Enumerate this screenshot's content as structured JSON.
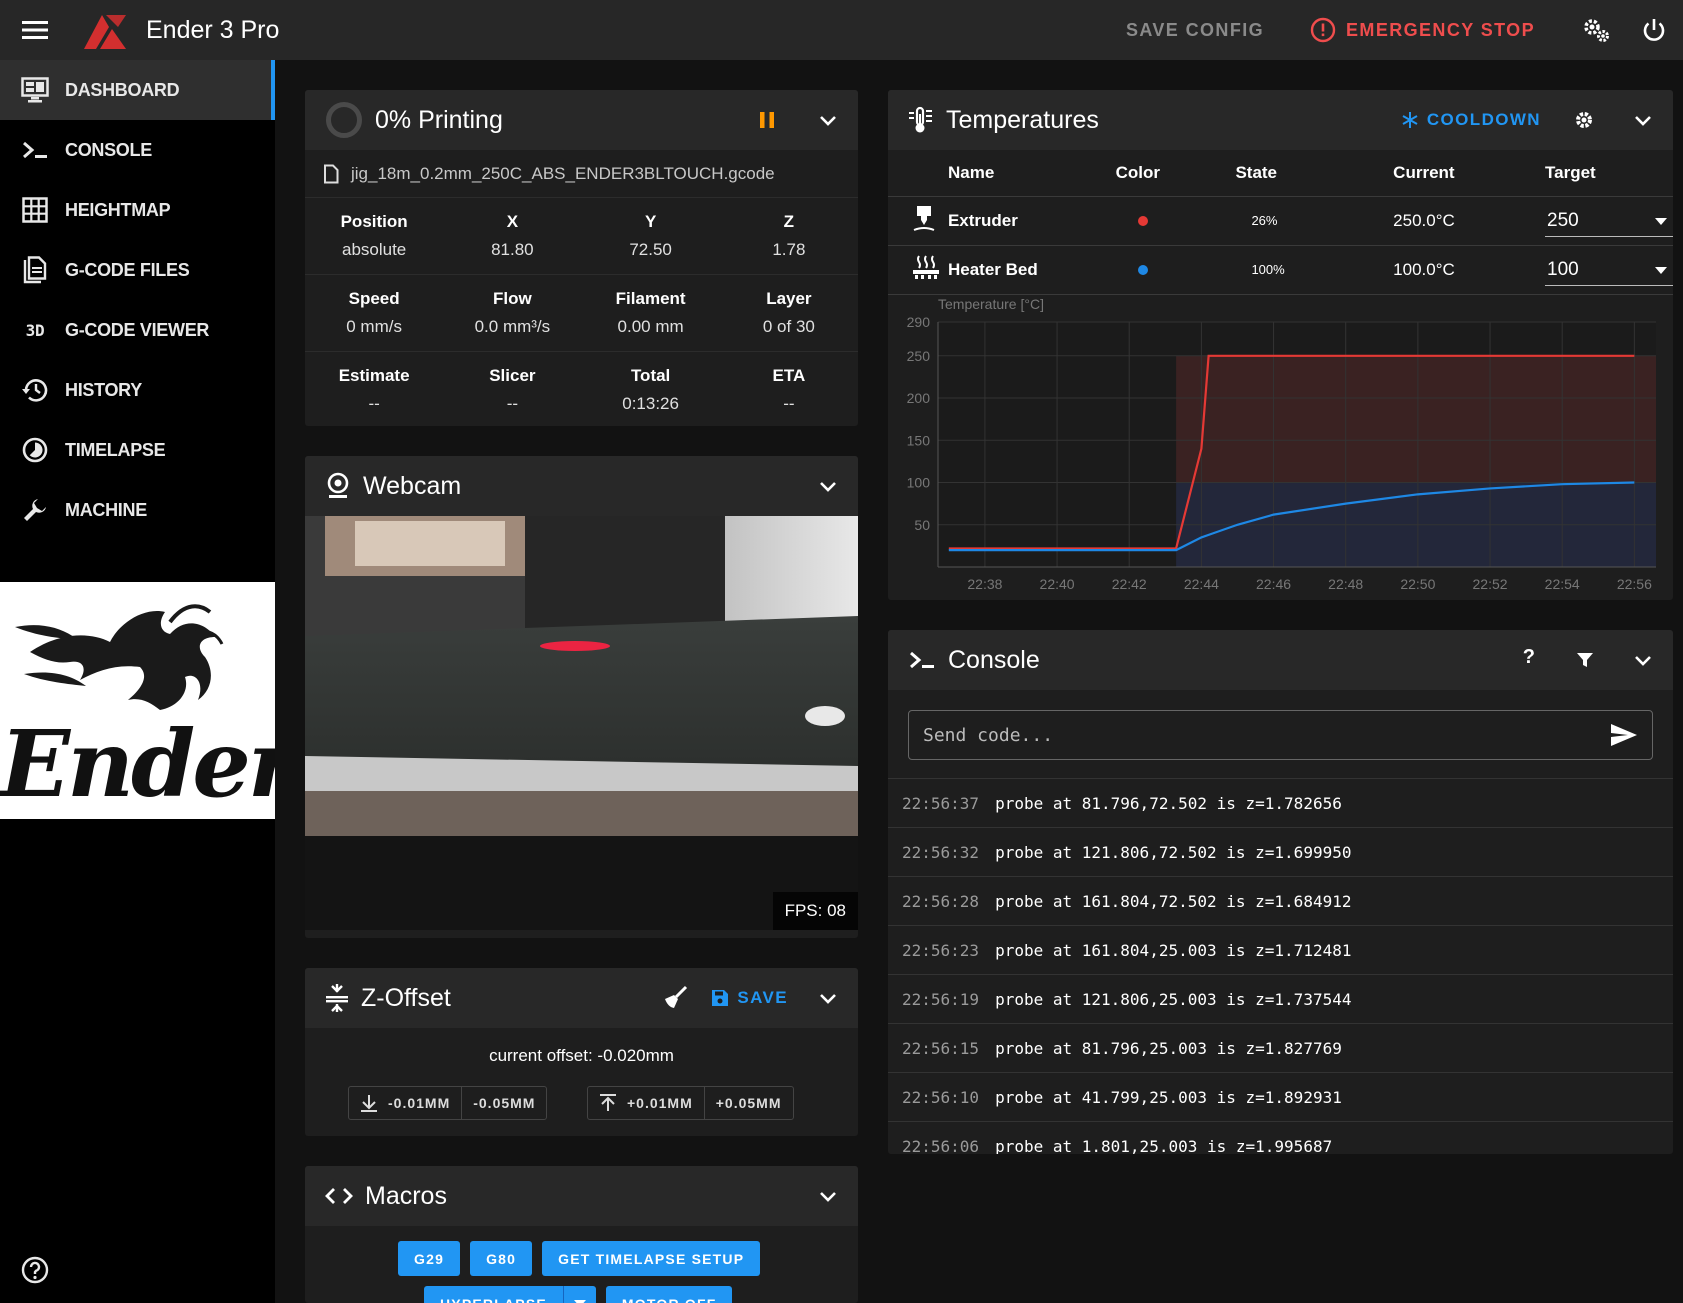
{
  "app": {
    "title": "Ender 3 Pro",
    "save_config": "SAVE CONFIG",
    "emergency_stop": "EMERGENCY STOP",
    "accent": "#2196f3",
    "danger": "#ef4d4d",
    "warning": "#ff9800"
  },
  "sidebar": {
    "items": [
      {
        "label": "DASHBOARD",
        "icon": "monitor-dashboard-icon",
        "active": true
      },
      {
        "label": "CONSOLE",
        "icon": "console-icon"
      },
      {
        "label": "HEIGHTMAP",
        "icon": "grid-icon"
      },
      {
        "label": "G-CODE FILES",
        "icon": "file-document-icon"
      },
      {
        "label": "G-CODE VIEWER",
        "icon": "3d-icon",
        "icon_text": "3D"
      },
      {
        "label": "HISTORY",
        "icon": "history-icon"
      },
      {
        "label": "TIMELAPSE",
        "icon": "timelapse-icon"
      },
      {
        "label": "MACHINE",
        "icon": "wrench-icon"
      }
    ],
    "logo_text": "Ender"
  },
  "status": {
    "title": "0% Printing",
    "progress": 0,
    "file": "jig_18m_0.2mm_250C_ABS_ENDER3BLTOUCH.gcode",
    "row1": {
      "headers": [
        "Position",
        "X",
        "Y",
        "Z"
      ],
      "values": [
        "absolute",
        "81.80",
        "72.50",
        "1.78"
      ]
    },
    "row2": {
      "headers": [
        "Speed",
        "Flow",
        "Filament",
        "Layer"
      ],
      "values": [
        "0 mm/s",
        "0.0 mm³/s",
        "0.00 mm",
        "0 of 30"
      ]
    },
    "row3": {
      "headers": [
        "Estimate",
        "Slicer",
        "Total",
        "ETA"
      ],
      "values": [
        "--",
        "--",
        "0:13:26",
        "--"
      ]
    }
  },
  "webcam": {
    "title": "Webcam",
    "fps": "FPS: 08"
  },
  "zoffset": {
    "title": "Z-Offset",
    "save": "SAVE",
    "current": "current offset: -0.020mm",
    "down_small": "-0.01MM",
    "down_big": "-0.05MM",
    "up_small": "+0.01MM",
    "up_big": "+0.05MM"
  },
  "macros": {
    "title": "Macros",
    "buttons": [
      "G29",
      "G80",
      "GET TIMELAPSE SETUP",
      "HYPERLAPSE",
      "MOTOR OFF"
    ]
  },
  "temperatures": {
    "title": "Temperatures",
    "cooldown": "COOLDOWN",
    "headers": [
      "Name",
      "Color",
      "State",
      "Current",
      "Target"
    ],
    "rows": [
      {
        "name": "Extruder",
        "color": "#e53935",
        "state": "26%",
        "current": "250.0°C",
        "target": "250"
      },
      {
        "name": "Heater Bed",
        "color": "#1e88e5",
        "state": "100%",
        "current": "100.0°C",
        "target": "100"
      }
    ]
  },
  "chart_data": {
    "type": "line",
    "ylabel": "Temperature [°C]",
    "ylim": [
      0,
      290
    ],
    "yticks": [
      50,
      100,
      150,
      200,
      250,
      290
    ],
    "xticks": [
      "22:38",
      "22:40",
      "22:42",
      "22:44",
      "22:46",
      "22:48",
      "22:50",
      "22:52",
      "22:54",
      "22:56"
    ],
    "x": [
      "22:37",
      "22:38",
      "22:40",
      "22:42",
      "22:43.3",
      "22:44",
      "22:44.2",
      "22:45",
      "22:46",
      "22:48",
      "22:50",
      "22:52",
      "22:54",
      "22:56"
    ],
    "series": [
      {
        "name": "Extruder",
        "color": "#e53935",
        "values": [
          22,
          22,
          22,
          22,
          22,
          140,
          250,
          250,
          250,
          250,
          250,
          250,
          250,
          250
        ]
      },
      {
        "name": "Heater Bed",
        "color": "#1e88e5",
        "values": [
          20,
          20,
          20,
          20,
          20,
          35,
          38,
          50,
          62,
          75,
          86,
          93,
          98,
          100
        ]
      }
    ],
    "grid": true
  },
  "console": {
    "title": "Console",
    "placeholder": "Send code...",
    "logs": [
      {
        "time": "22:56:37",
        "msg": "probe at 81.796,72.502 is z=1.782656"
      },
      {
        "time": "22:56:32",
        "msg": "probe at 121.806,72.502 is z=1.699950"
      },
      {
        "time": "22:56:28",
        "msg": "probe at 161.804,72.502 is z=1.684912"
      },
      {
        "time": "22:56:23",
        "msg": "probe at 161.804,25.003 is z=1.712481"
      },
      {
        "time": "22:56:19",
        "msg": "probe at 121.806,25.003 is z=1.737544"
      },
      {
        "time": "22:56:15",
        "msg": "probe at 81.796,25.003 is z=1.827769"
      },
      {
        "time": "22:56:10",
        "msg": "probe at 41.799,25.003 is z=1.892931"
      },
      {
        "time": "22:56:06",
        "msg": "probe at 1.801,25.003 is z=1.995687"
      }
    ]
  }
}
